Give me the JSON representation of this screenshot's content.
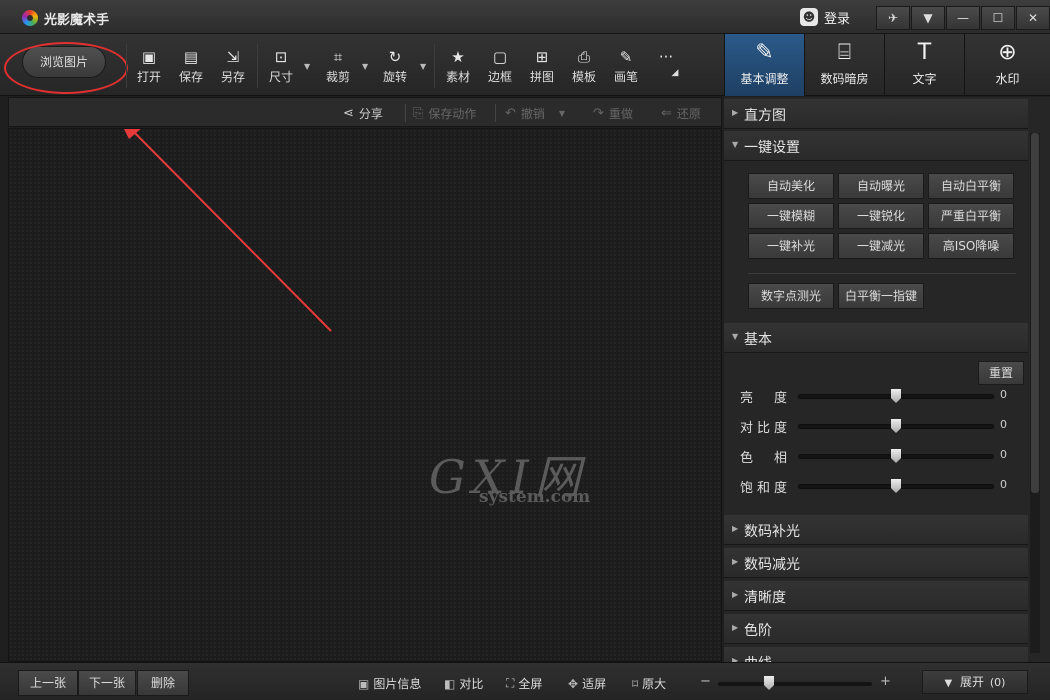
{
  "titlebar": {
    "title": "光影魔术手",
    "login_icon": "☻",
    "login_label": "登录",
    "buttons": [
      {
        "icon": "skin-icon",
        "glyph": "✈"
      },
      {
        "icon": "menu-icon",
        "glyph": "▼"
      },
      {
        "icon": "minimize-icon",
        "glyph": "—"
      },
      {
        "icon": "maximize-icon",
        "glyph": "☐"
      },
      {
        "icon": "close-icon",
        "glyph": "✕"
      }
    ]
  },
  "toolbar": {
    "browse_label": "浏览图片",
    "tools": [
      {
        "label": "打开",
        "glyph": "▣"
      },
      {
        "label": "保存",
        "glyph": "▤"
      },
      {
        "label": "另存",
        "glyph": "⇲"
      },
      {
        "label": "尺寸",
        "glyph": "⊡"
      },
      {
        "label": "裁剪",
        "glyph": "⌗"
      },
      {
        "label": "旋转",
        "glyph": "↻"
      },
      {
        "label": "素材",
        "glyph": "★"
      },
      {
        "label": "边框",
        "glyph": "▢"
      },
      {
        "label": "拼图",
        "glyph": "⊞"
      },
      {
        "label": "模板",
        "glyph": "⎙"
      },
      {
        "label": "画笔",
        "glyph": "✎"
      }
    ],
    "more_glyph": "···"
  },
  "right_tabs": [
    {
      "label": "基本调整",
      "glyph": "✎"
    },
    {
      "label": "数码暗房",
      "glyph": "⌸"
    },
    {
      "label": "文字",
      "glyph": "T"
    },
    {
      "label": "水印",
      "glyph": "⊕"
    }
  ],
  "actions": {
    "share": "分享",
    "save_action": "保存动作",
    "undo": "撤销",
    "redo": "重做",
    "restore": "还原"
  },
  "watermark": {
    "big": "GXI网",
    "small": "system.com"
  },
  "panel": {
    "histogram": "直方图",
    "one_click": {
      "title": "一键设置",
      "buttons": [
        "自动美化",
        "自动曝光",
        "自动白平衡",
        "一键模糊",
        "一键锐化",
        "严重白平衡",
        "一键补光",
        "一键减光",
        "高ISO降噪"
      ],
      "extra": [
        "数字点测光",
        "白平衡一指键"
      ]
    },
    "basic": {
      "title": "基本",
      "reset": "重置",
      "sliders": [
        {
          "label": "亮　度",
          "value": 0
        },
        {
          "label": "对比度",
          "value": 0
        },
        {
          "label": "色　相",
          "value": 0
        },
        {
          "label": "饱和度",
          "value": 0
        }
      ]
    },
    "collapsed": [
      "数码补光",
      "数码减光",
      "清晰度",
      "色阶",
      "曲线"
    ]
  },
  "bottom": {
    "prev": "上一张",
    "next": "下一张",
    "delete": "删除",
    "info": "图片信息",
    "compare": "对比",
    "fullscreen": "全屏",
    "fit": "适屏",
    "original": "原大",
    "zoom_minus": "−",
    "zoom_plus": "+",
    "expand": "展开",
    "expand_count": "(0)"
  }
}
